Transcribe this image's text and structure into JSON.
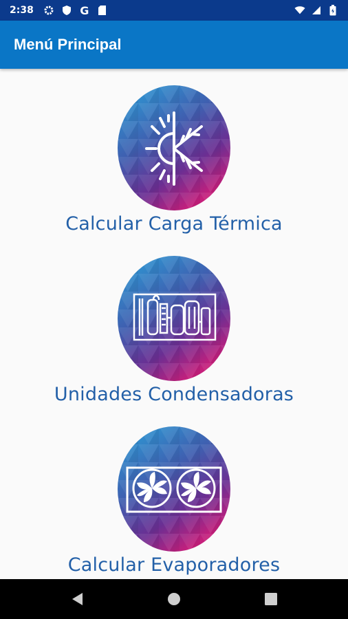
{
  "status_bar": {
    "time": "2:38",
    "left_icons": [
      "gear-icon",
      "shield-icon",
      "google-g-icon",
      "sd-card-icon"
    ],
    "right_icons": [
      "wifi-icon",
      "cell-signal-icon",
      "battery-icon"
    ],
    "google_letter": "G"
  },
  "app_bar": {
    "title": "Menú Principal",
    "color": "#0a76c6"
  },
  "menu": {
    "items": [
      {
        "label": "Calcular Carga Térmica",
        "icon": "sun-snowflake-icon"
      },
      {
        "label": "Unidades Condensadoras",
        "icon": "condenser-unit-icon"
      },
      {
        "label": "Calcular Evaporadores",
        "icon": "evaporator-fans-icon"
      }
    ],
    "label_color": "#2360a8",
    "gradient": [
      "#2a9fd8",
      "#4a3c9e",
      "#c2237d"
    ]
  },
  "nav_bar": {
    "buttons": [
      "back-icon",
      "home-icon",
      "recents-icon"
    ]
  }
}
